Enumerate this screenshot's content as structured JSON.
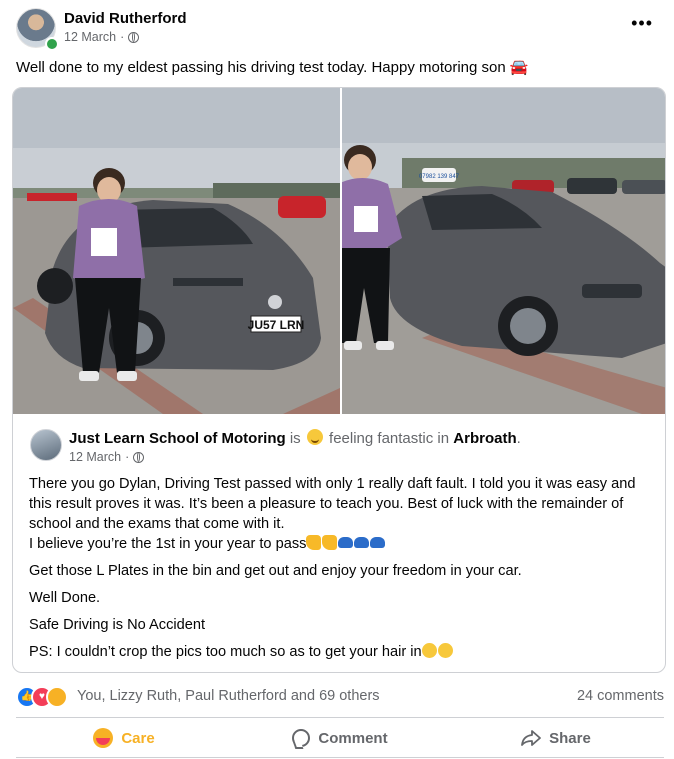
{
  "post": {
    "author": "David Rutherford",
    "date": "12 March",
    "text": "Well done to my eldest passing his driving test today. Happy motoring son 🚘"
  },
  "shared": {
    "page_name": "Just Learn School of Motoring",
    "is_word": "is",
    "feeling": "feeling fantastic in",
    "location": "Arbroath",
    "date": "12 March",
    "paragraphs": [
      "There you go Dylan, Driving Test passed with only 1 really daft fault. I told you it was easy and this result proves it was.  It’s been a pleasure to teach you.  Best of luck with the remainder of school and the exams that come with it.",
      "I believe you’re the 1st in your year to pass",
      "Get those L Plates in the bin and get out and enjoy your freedom in your car.",
      "Well Done.",
      "Safe Driving is No Accident",
      "PS: I couldn’t crop the pics too much so as to get your hair in"
    ],
    "plate": "JU57 LRN",
    "sign": "07982 139 847"
  },
  "reactions": {
    "names": "You, Lizzy Ruth, Paul Rutherford and 69 others",
    "comments": "24 comments",
    "icons": [
      "like-icon",
      "love-icon",
      "care-icon"
    ]
  },
  "actions": {
    "care": "Care",
    "comment": "Comment",
    "share": "Share"
  },
  "colors": {
    "accent_blue": "#1877f2",
    "care_yellow": "#f7b125",
    "muted": "#65676b",
    "car_grey": "#55575c"
  }
}
